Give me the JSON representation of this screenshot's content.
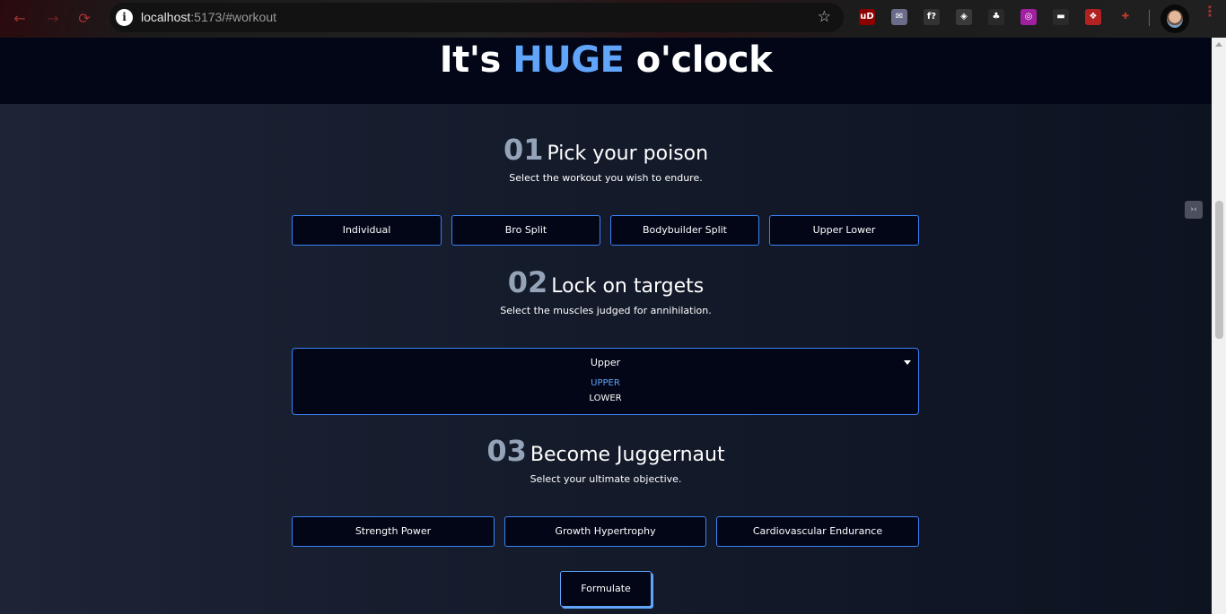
{
  "browser": {
    "url_host": "localhost",
    "url_rest": ":5173/#workout",
    "back_icon": "←",
    "forward_icon": "→",
    "reload_icon": "⟳",
    "info_icon": "i",
    "star_icon": "☆",
    "extensions": [
      {
        "name": "ublock-icon",
        "text": "uD",
        "color": "#8b0000"
      },
      {
        "name": "mail-ext-icon",
        "text": "✉",
        "color": "#6b6b8a"
      },
      {
        "name": "fontface-ext-icon",
        "text": "f?",
        "color": "#333333"
      },
      {
        "name": "shield-ext-icon",
        "text": "◈",
        "color": "#3a3a3a"
      },
      {
        "name": "tree-ext-icon",
        "text": "♣",
        "color": "#2a2a2a"
      },
      {
        "name": "purple-ext-icon",
        "text": "◎",
        "color": "#a020a0"
      },
      {
        "name": "gamepad-ext-icon",
        "text": "▬",
        "color": "#2a2a2a"
      },
      {
        "name": "red-ext-icon",
        "text": "❖",
        "color": "#b22222"
      },
      {
        "name": "puzzle-icon",
        "text": "✚",
        "color": "#2a2a2a"
      }
    ],
    "kebab_icon": "⋮"
  },
  "hero": {
    "prefix": "It's ",
    "accent": "HUGE",
    "suffix": " o'clock"
  },
  "steps": [
    {
      "num": "01",
      "title": "Pick your poison",
      "subtitle": "Select the workout you wish to endure."
    },
    {
      "num": "02",
      "title": "Lock on targets",
      "subtitle": "Select the muscles judged for annihilation."
    },
    {
      "num": "03",
      "title": "Become Juggernaut",
      "subtitle": "Select your ultimate objective."
    }
  ],
  "workouts": [
    "Individual",
    "Bro Split",
    "Bodybuilder Split",
    "Upper Lower"
  ],
  "muscle_select": {
    "value": "Upper",
    "options": [
      "UPPER",
      "LOWER"
    ],
    "highlighted_color": "#60a5fa"
  },
  "objectives": [
    "Strength Power",
    "Growth Hypertrophy",
    "Cardiovascular Endurance"
  ],
  "formulate_label": "Formulate",
  "float_icon_text": "›‹",
  "colors": {
    "accent": "#60a5fa",
    "border": "#3b82f6",
    "panel": "#020617"
  }
}
